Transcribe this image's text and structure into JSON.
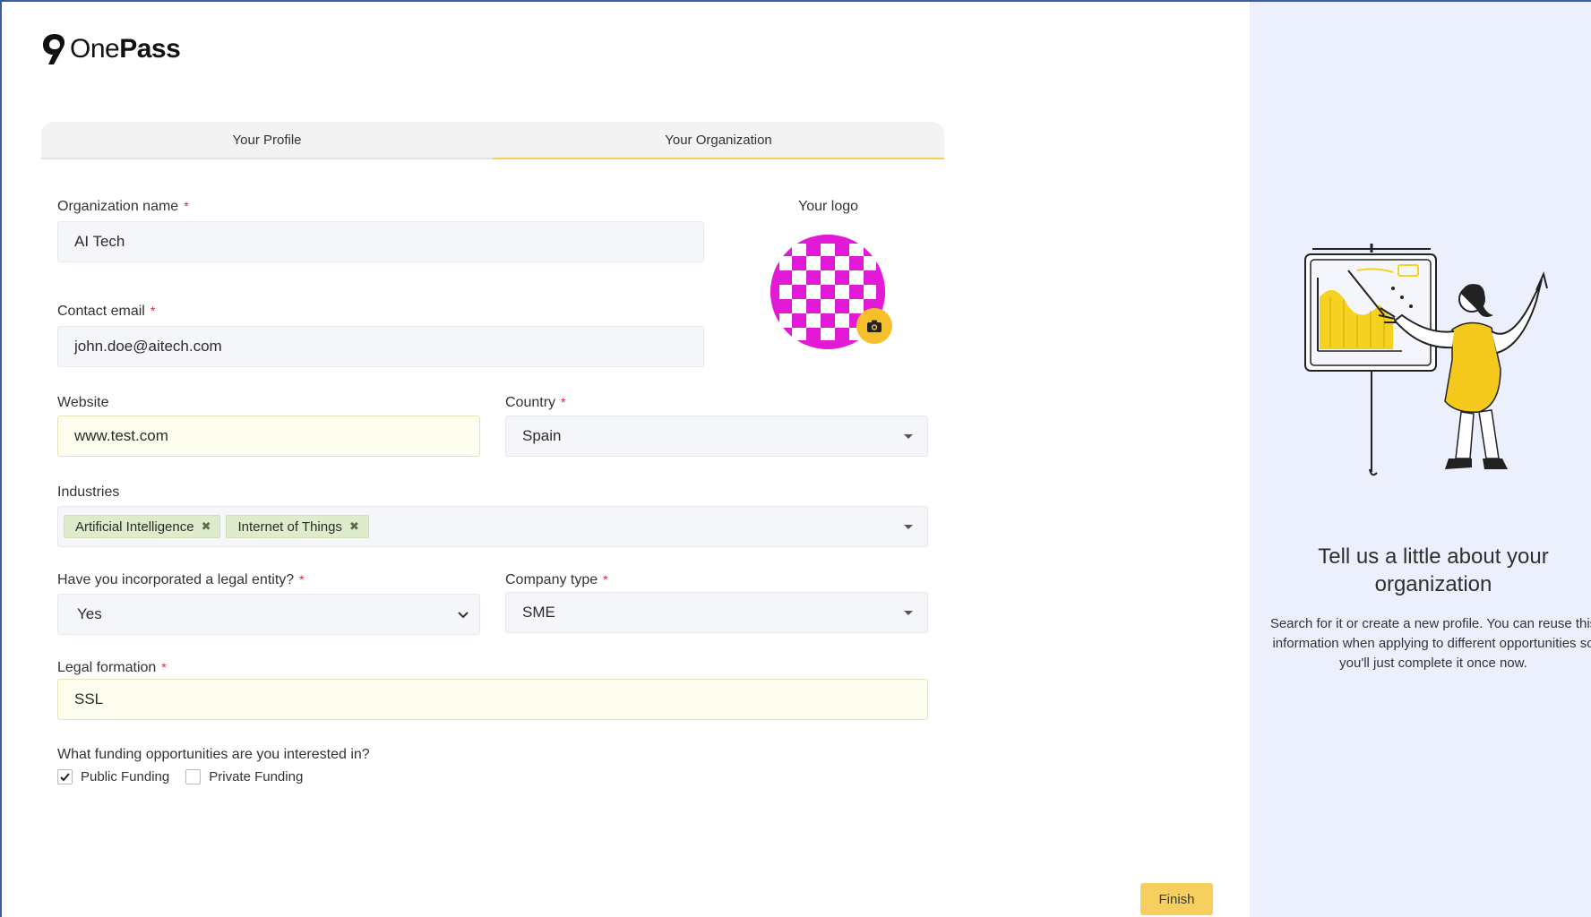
{
  "brand": {
    "name_light": "One",
    "name_bold": "Pass"
  },
  "tabs": [
    {
      "label": "Your Profile",
      "active": false
    },
    {
      "label": "Your Organization",
      "active": true
    }
  ],
  "form": {
    "org_name": {
      "label": "Organization name",
      "required": "*",
      "value": "AI Tech"
    },
    "contact_email": {
      "label": "Contact email",
      "required": "*",
      "value": "john.doe@aitech.com"
    },
    "website": {
      "label": "Website",
      "value": "www.test.com"
    },
    "country": {
      "label": "Country",
      "required": "*",
      "value": "Spain"
    },
    "industries": {
      "label": "Industries",
      "chips": [
        "Artificial Intelligence",
        "Internet of Things"
      ],
      "remove_glyph": "✖"
    },
    "legal_entity": {
      "label": "Have you incorporated a legal entity?",
      "required": "*",
      "value": "Yes"
    },
    "company_type": {
      "label": "Company type",
      "required": "*",
      "value": "SME"
    },
    "legal_formation": {
      "label": "Legal formation",
      "required": "*",
      "value": "SSL"
    },
    "funding": {
      "label": "What funding opportunities are you interested in?",
      "options": [
        {
          "label": "Public Funding",
          "checked": true
        },
        {
          "label": "Private Funding",
          "checked": false
        }
      ]
    },
    "logo": {
      "label": "Your logo"
    }
  },
  "actions": {
    "finish_label": "Finish"
  },
  "side": {
    "title": "Tell us a little about your organization",
    "description": "Search for it or create a new profile. You can reuse this information when applying to different opportunities so you'll just complete it once now."
  },
  "colors": {
    "accent": "#f6cf5e",
    "required": "#e0243a",
    "chip_bg": "#dfeccb",
    "logo_magenta": "#e21ad6",
    "side_bg": "#ecf0fd"
  },
  "icons": {
    "camera": "camera-icon",
    "check": "check-icon",
    "chevron": "chevron-down-icon"
  }
}
